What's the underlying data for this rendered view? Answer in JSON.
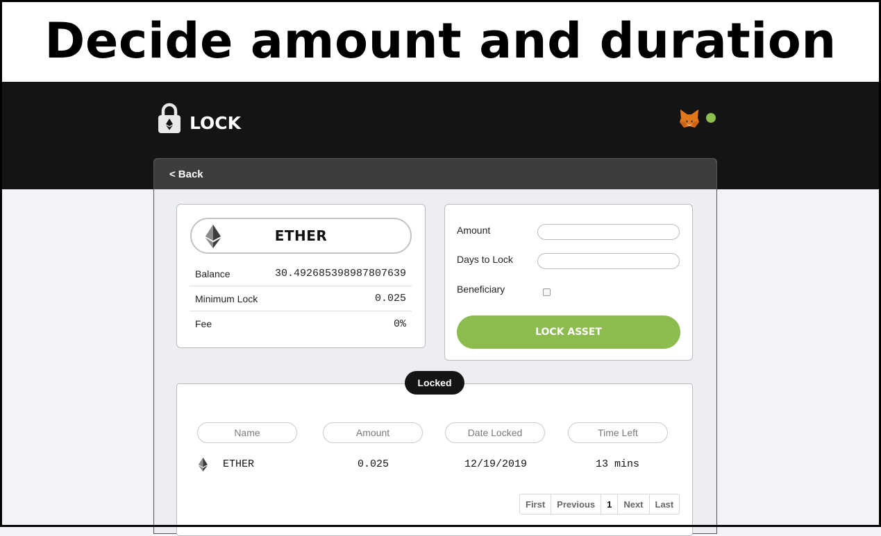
{
  "banner": {
    "title": "Decide amount and duration"
  },
  "header": {
    "brand_label": "LOCK",
    "status_color": "#8cc04b",
    "wallet_icon": "metamask-fox-icon"
  },
  "nav": {
    "back_label": "Back"
  },
  "asset": {
    "name": "ETHER",
    "rows": [
      {
        "label": "Balance",
        "value": "30.492685398987807639"
      },
      {
        "label": "Minimum Lock",
        "value": "0.025"
      },
      {
        "label": "Fee",
        "value": "0%"
      }
    ]
  },
  "form": {
    "amount_label": "Amount",
    "days_label": "Days to Lock",
    "beneficiary_label": "Beneficiary",
    "amount_value": "",
    "days_value": "",
    "beneficiary_checked": false,
    "submit_label": "LOCK ASSET",
    "accent": "#8cbb4e"
  },
  "locked": {
    "badge": "Locked",
    "columns": [
      "Name",
      "Amount",
      "Date Locked",
      "Time Left"
    ],
    "rows": [
      {
        "name": "ETHER",
        "amount": "0.025",
        "date_locked": "12/19/2019",
        "time_left": "13 mins"
      }
    ],
    "pagination": {
      "first": "First",
      "previous": "Previous",
      "current": "1",
      "next": "Next",
      "last": "Last"
    }
  }
}
